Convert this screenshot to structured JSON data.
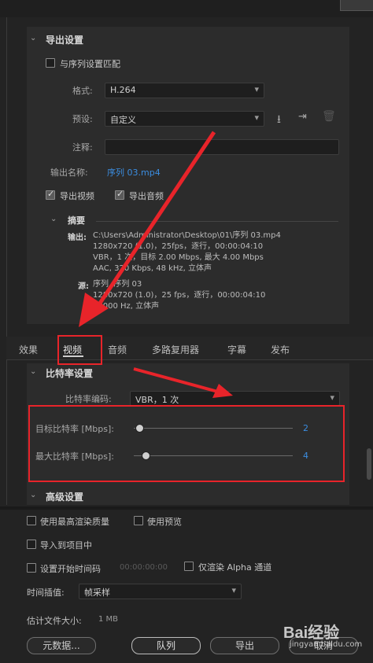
{
  "export_settings": {
    "title": "导出设置",
    "match_sequence_label": "与序列设置匹配",
    "format_label": "格式:",
    "format_value": "H.264",
    "preset_label": "预设:",
    "preset_value": "自定义",
    "comment_label": "注释:",
    "comment_value": "",
    "output_name_label": "输出名称:",
    "output_name_value": "序列 03.mp4",
    "export_video_label": "导出视频",
    "export_audio_label": "导出音频",
    "summary_title": "摘要",
    "output_label": "输出:",
    "output_lines": [
      "C:\\Users\\Administrator\\Desktop\\01\\序列 03.mp4",
      "1280x720 (1.0)，25fps，逐行，00:00:04:10",
      "VBR，1 次，目标 2.00 Mbps, 最大 4.00 Mbps",
      "AAC, 320 Kbps, 48  kHz, 立体声"
    ],
    "source_label": "源:",
    "source_lines": [
      "序列, 序列 03",
      "1280x720 (1.0)，25 fps，逐行，00:00:04:10",
      "48000 Hz, 立体声"
    ]
  },
  "tabs": [
    "效果",
    "视频",
    "音频",
    "多路复用器",
    "字幕",
    "发布"
  ],
  "active_tab": "视频",
  "bitrate": {
    "title": "比特率设置",
    "encoding_label": "比特率编码:",
    "encoding_value": "VBR，1 次",
    "target_label": "目标比特率 [Mbps]:",
    "target_value": "2",
    "max_label": "最大比特率 [Mbps]:",
    "max_value": "4"
  },
  "advanced_title": "高级设置",
  "bottom": {
    "max_quality_label": "使用最高渲染质量",
    "use_preview_label": "使用预览",
    "import_project_label": "导入到项目中",
    "set_start_tc_label": "设置开始时间码",
    "start_tc_value": "00:00:00:00",
    "render_alpha_label": "仅渲染 Alpha 通道",
    "time_interp_label": "时间插值:",
    "time_interp_value": "帧采样",
    "est_size_label": "估计文件大小:",
    "est_size_value": "1 MB",
    "metadata_button": "元数据...",
    "queue_button": "队列",
    "export_button": "导出",
    "cancel_button": "取消"
  },
  "watermark": {
    "brand": "Bai经验",
    "url": "jingyan.baidu.com"
  },
  "colors": {
    "annotation_red": "#e8242a",
    "link_blue": "#3b8de0"
  }
}
